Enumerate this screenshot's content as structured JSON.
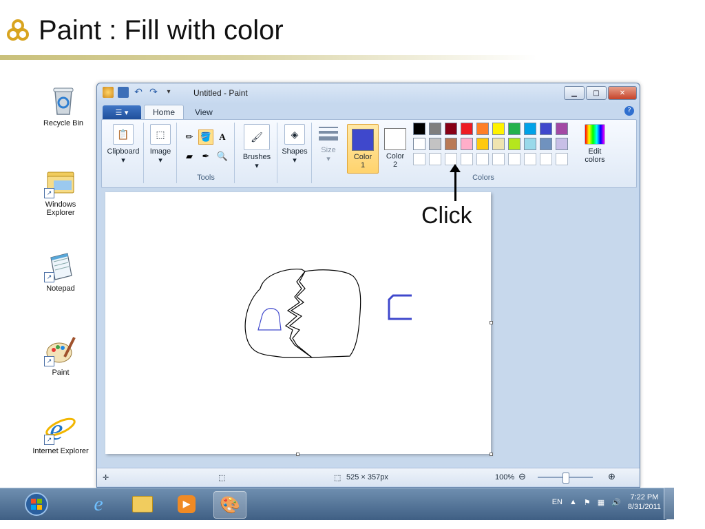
{
  "slide": {
    "title": "Paint : Fill with color"
  },
  "desktop": {
    "icons": [
      {
        "label": "Recycle Bin"
      },
      {
        "label": "Windows Explorer"
      },
      {
        "label": "Notepad"
      },
      {
        "label": "Paint"
      },
      {
        "label": "Internet Explorer"
      }
    ]
  },
  "window": {
    "title": "Untitled - Paint",
    "tabs": [
      "Home",
      "View"
    ],
    "groups": {
      "clipboard": "Clipboard",
      "image": "Image",
      "tools": "Tools",
      "brushes": "Brushes",
      "shapes": "Shapes",
      "size": "Size",
      "colors": "Colors"
    },
    "color1": {
      "label": "Color",
      "num": "1",
      "value": "#3f48cc"
    },
    "color2": {
      "label": "Color",
      "num": "2",
      "value": "#ffffff"
    },
    "edit_colors": {
      "line1": "Edit",
      "line2": "colors"
    },
    "palette_row1": [
      "#000000",
      "#7f7f7f",
      "#880015",
      "#ed1c24",
      "#ff7f27",
      "#fff200",
      "#22b14c",
      "#00a2e8",
      "#3f48cc",
      "#a349a4"
    ],
    "palette_row2": [
      "#ffffff",
      "#c3c3c3",
      "#b97a57",
      "#ffaec9",
      "#ffc90e",
      "#efe4b0",
      "#b5e61d",
      "#99d9ea",
      "#7092be",
      "#c8bfe7"
    ]
  },
  "status": {
    "canvas_size": "525 × 357px",
    "zoom": "100%"
  },
  "annotation": {
    "label": "Click"
  },
  "taskbar": {
    "lang": "EN",
    "time": "7:22 PM",
    "date": "8/31/2011"
  }
}
